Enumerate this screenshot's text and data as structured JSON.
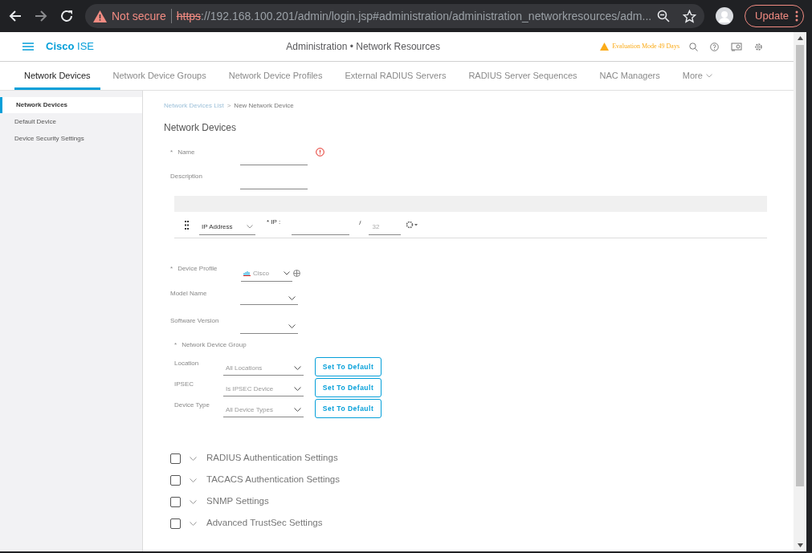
{
  "browser": {
    "security": "Not secure",
    "url_scheme": "https",
    "url_rest": "://192.168.100.201/admin/login.jsp#administration/administration_networkresources/adm...",
    "update": "Update"
  },
  "header": {
    "brand_1": "Cisco",
    "brand_2": "ISE",
    "title": "Administration • Network Resources",
    "evaluation": "Evaluation Mode 49 Days"
  },
  "tabs": [
    {
      "label": "Network Devices",
      "selected": true
    },
    {
      "label": "Network Device Groups",
      "selected": false
    },
    {
      "label": "Network Device Profiles",
      "selected": false
    },
    {
      "label": "External RADIUS Servers",
      "selected": false
    },
    {
      "label": "RADIUS Server Sequences",
      "selected": false
    },
    {
      "label": "NAC Managers",
      "selected": false
    },
    {
      "label": "More",
      "selected": false
    }
  ],
  "sidebar": {
    "items": [
      {
        "label": "Network Devices",
        "selected": true
      },
      {
        "label": "Default Device",
        "selected": false
      },
      {
        "label": "Device Security Settings",
        "selected": false
      }
    ]
  },
  "breadcrumb": {
    "link": "Network Devices List",
    "separator": ">",
    "current": "New Network Device"
  },
  "heading": "Network Devices",
  "name_field": {
    "required_mark": "*",
    "label": "Name"
  },
  "description_field": {
    "label": "Description"
  },
  "ip_row": {
    "type": "IP Address",
    "ip_label": "* IP :",
    "slash": "/",
    "mask": "32"
  },
  "device_profile": {
    "required_mark": "*",
    "label": "Device Profile",
    "value": "Cisco"
  },
  "model_name": {
    "label": "Model Name"
  },
  "software_version": {
    "label": "Software Version"
  },
  "network_device_group": {
    "required_mark": "*",
    "label": "Network Device Group",
    "groups": [
      {
        "label": "Location",
        "value": "All Locations",
        "button": "Set To Default"
      },
      {
        "label": "IPSEC",
        "value": "Is IPSEC Device",
        "button": "Set To Default"
      },
      {
        "label": "Device Type",
        "value": "All Device Types",
        "button": "Set To Default"
      }
    ]
  },
  "sections": [
    {
      "label": "RADIUS Authentication Settings",
      "checked": false,
      "expanded": false
    },
    {
      "label": "TACACS Authentication Settings",
      "checked": false,
      "expanded": false
    },
    {
      "label": "SNMP Settings",
      "checked": false,
      "expanded": false
    },
    {
      "label": "Advanced TrustSec Settings",
      "checked": false,
      "expanded": false
    }
  ]
}
